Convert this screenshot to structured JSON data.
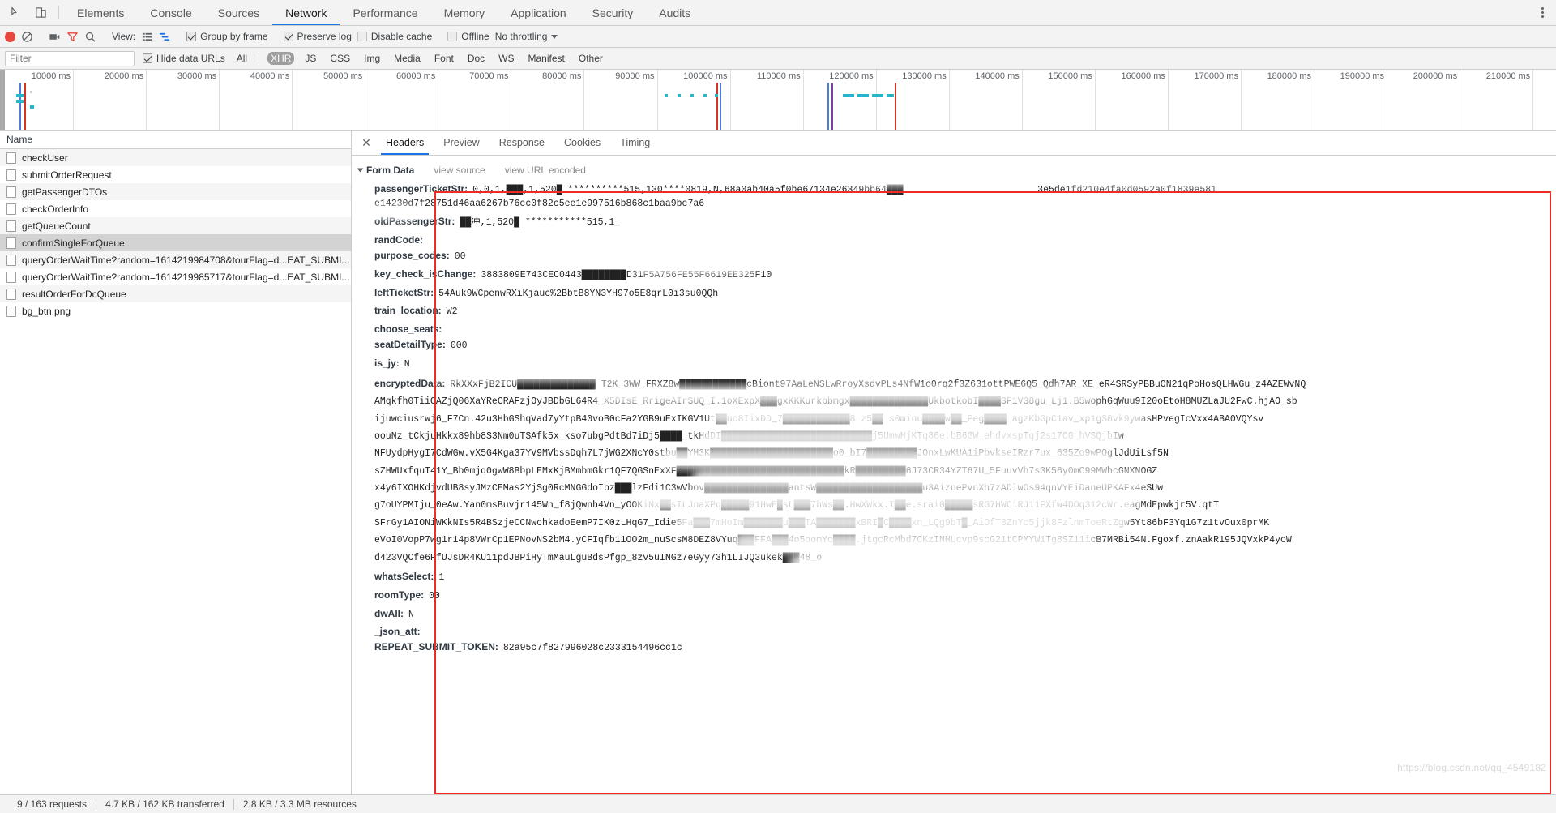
{
  "window": {
    "devtools_tabs": [
      {
        "label": "Elements",
        "active": false
      },
      {
        "label": "Console",
        "active": false
      },
      {
        "label": "Sources",
        "active": false
      },
      {
        "label": "Network",
        "active": true
      },
      {
        "label": "Performance",
        "active": false
      },
      {
        "label": "Memory",
        "active": false
      },
      {
        "label": "Application",
        "active": false
      },
      {
        "label": "Security",
        "active": false
      },
      {
        "label": "Audits",
        "active": false
      }
    ],
    "inspect_icon": "inspect-element-icon",
    "device_icon": "device-toolbar-icon",
    "menu_icon": "kebab-menu-icon"
  },
  "toolbar": {
    "record_icon": "record-button",
    "clear_icon": "clear-button",
    "capture_screenshots_icon": "camera-icon",
    "filter_icon": "funnel-icon",
    "search_icon": "search-icon",
    "view_label": "View:",
    "view_list_icon": "list-view-icon",
    "view_waterfall_icon": "waterfall-view-icon",
    "group_by_frame": {
      "label": "Group by frame",
      "checked": true
    },
    "preserve_log": {
      "label": "Preserve log",
      "checked": true
    },
    "disable_cache": {
      "label": "Disable cache",
      "checked": false
    },
    "offline": {
      "label": "Offline",
      "checked": false
    },
    "throttling": {
      "value": "No throttling",
      "caret_icon": "chevron-down-icon"
    }
  },
  "filterbar": {
    "filter_placeholder": "Filter",
    "filter_value": "",
    "hide_data_urls": {
      "label": "Hide data URLs",
      "checked": true
    },
    "types": [
      {
        "label": "All",
        "selected": false
      },
      {
        "label": "XHR",
        "selected": true
      },
      {
        "label": "JS",
        "selected": false
      },
      {
        "label": "CSS",
        "selected": false
      },
      {
        "label": "Img",
        "selected": false
      },
      {
        "label": "Media",
        "selected": false
      },
      {
        "label": "Font",
        "selected": false
      },
      {
        "label": "Doc",
        "selected": false
      },
      {
        "label": "WS",
        "selected": false
      },
      {
        "label": "Manifest",
        "selected": false
      },
      {
        "label": "Other",
        "selected": false
      }
    ]
  },
  "overview": {
    "ticks": [
      "10000 ms",
      "20000 ms",
      "30000 ms",
      "40000 ms",
      "50000 ms",
      "60000 ms",
      "70000 ms",
      "80000 ms",
      "90000 ms",
      "100000 ms",
      "110000 ms",
      "120000 ms",
      "130000 ms",
      "140000 ms",
      "150000 ms",
      "160000 ms",
      "170000 ms",
      "180000 ms",
      "190000 ms",
      "200000 ms",
      "210000 ms"
    ]
  },
  "requests": {
    "column_header": "Name",
    "rows": [
      {
        "name": "checkUser",
        "selected": false
      },
      {
        "name": "submitOrderRequest",
        "selected": false
      },
      {
        "name": "getPassengerDTOs",
        "selected": false
      },
      {
        "name": "checkOrderInfo",
        "selected": false
      },
      {
        "name": "getQueueCount",
        "selected": false
      },
      {
        "name": "confirmSingleForQueue",
        "selected": true
      },
      {
        "name": "queryOrderWaitTime?random=1614219984708&tourFlag=d...EAT_SUBMI...",
        "selected": false
      },
      {
        "name": "queryOrderWaitTime?random=1614219985717&tourFlag=d...EAT_SUBMI...",
        "selected": false
      },
      {
        "name": "resultOrderForDcQueue",
        "selected": false
      },
      {
        "name": "bg_btn.png",
        "selected": false
      }
    ]
  },
  "detail": {
    "close_icon": "close-icon",
    "tabs": [
      {
        "label": "Headers",
        "active": true
      },
      {
        "label": "Preview",
        "active": false
      },
      {
        "label": "Response",
        "active": false
      },
      {
        "label": "Cookies",
        "active": false
      },
      {
        "label": "Timing",
        "active": false
      }
    ],
    "section": {
      "title": "Form Data",
      "expanded": true,
      "view_source": "view source",
      "view_url_encoded": "view URL encoded"
    },
    "form_data": [
      {
        "key": "passengerTicketStr",
        "value": "0,0,1,███,1,520█ **********515,130****0819,N,68a0ab40a5f0be67134e26349bb64███                        3e5de1fd210e4fa0d0592a0f1839e581",
        "value2": "e14230d7f28751d46aa6267b76cc0f82c5ee1e997516b868c1baa9bc7a6",
        "multiline": true
      },
      {
        "key": "oldPassengerStr",
        "value": "██冲,1,520█ ***********515,1_"
      },
      {
        "key": "randCode",
        "value": ""
      },
      {
        "key": "purpose_codes",
        "value": "00"
      },
      {
        "key": "key_check_isChange",
        "value": "3883809E743CEC0443████████D31F5A756FE55F6619EE325F10"
      },
      {
        "key": "leftTicketStr",
        "value": "54Auk9WCpenwRXiKjauc%2BbtB8YN3YH97o5E8qrL0i3su0QQh"
      },
      {
        "key": "train_location",
        "value": "W2"
      },
      {
        "key": "choose_seats",
        "value": ""
      },
      {
        "key": "seatDetailType",
        "value": "000"
      },
      {
        "key": "is_jy",
        "value": "N"
      },
      {
        "key": "encryptedData",
        "multiline": true,
        "lines": [
          "RkXXxFjB2ICU██████████████ T2K_3WW_FRXZ8w████████████cBiont97AaLeNSLwRroyXsdvPLs4NfW1o0rq2f3Z631ottPWE6Q5_Qdh7AR_XE_eR4SRSyPBBuON21qPoHosQLHWGu_z4AZEWvNQ",
          "AMqkfh0TiiOAZjQ06XaYReCRAFzjOyJBDbGL64R4_X5DIsE_RrigeAIrSUQ_I.1oXExpX███gxKKKurkbbmgx██████████████UkbotkobI████3F1V38gu_Lj1.B5wophGqWuu9I20oEtoH8MUZLaJU2FwC.hjAO_sb",
          "ijuwciusrwj6_F7Cn.42u3HbGShqVad7yYtpB40voB0cFa2YGB9uExIKGV1Ut██uc8IixDD_7████████████8 z5██ s0minu████w██_Peg████ agzKbGpC1av_xp1gS0vk9ywasHPvegIcVxx4ABA0VQYsv",
          "oouNz_tCkjuHkkx89hb8S3Nm0uTSAfk5x_kso7ubgPdtBd7iDj5████_tkHdDI███████████████████████████j5UmwHjKTq86e.bB6GW_ehdvxspTqj2s17CG_hVSQjbIw",
          "NFUydpHygI7CdWGw.vX5G4Kga37YV9MVbssDqh7L7jWG2XNcY0stbu██YH3K██████████████████████o0_bI7█████████JOnxLwKUA1iPbvkseIRzr7ux_635Zo9wPOglJdUiLsf5N",
          "sZHWUxfquT41Y_Bb0mjq0gwW8BbpLEMxKjBMmbmGkr1QF7QGSnExXF██████████████████████████████kR█████████6J73CR34YZT67U_5FuuvVh7s3K56y0mC99MWhcGNXNOGZ",
          "x4y6IXOHKdjvdUB8syJMzCEMas2YjSg0RcMNGGdoIbz███lzFdi1C3wVbov███████████████antsW███████████████████u3AiznePvnXh7zADlwOs94qnVYEiDaneUPKAFx4eSUw",
          "g7oUYPMIju_0eAw.Yan0msBuvjr145Wn_f8jQwnh4Vn_yOOKiMx██sILJnaXPq█████91HwE█sL███7hWs██.HwXWkx.I██e.srai0█████sRG7HWCiRJ11FXfw4DOq312cWr.eagMdEpwkjr5V.qtT",
          "SFrGy1AIONiWKkNIs5R4BSzjeCCNwchkadoEemP7IK0zLHqG7_Idie5Fa███7mHoIm███████u███TA███████xBRI█C████xn_LQg9bT█_AiOfT8ZnYc5jjk8FzlnmToeRtZgw5Yt86bF3Yq1G7z1tvOux0prMK",
          "eVoI0VopP7wg1r14p8VWrCp1EPNovNS2bM4.yCFIqfb11OO2m_nuScsM8DEZ8VYuq███FFA███4o5oomYc████.jtgcRcMbd7CKzINHUcvp9scG21tCPMYW1Tg8SZ11icB7MRBi54N.Fgoxf.znAakR195JQVxkP4yoW",
          "d423VQCfe6PfUJsDR4KU11pdJBPiHyTmMauLguBdsPfgp_8zv5uINGz7eGyy73h1LIJQ3ukek███48_o"
        ]
      },
      {
        "key": "whatsSelect",
        "value": "1"
      },
      {
        "key": "roomType",
        "value": "00"
      },
      {
        "key": "dwAll",
        "value": "N"
      },
      {
        "key": "_json_att",
        "value": ""
      },
      {
        "key": "REPEAT_SUBMIT_TOKEN",
        "value": "82a95c7f827996028c2333154496cc1c"
      }
    ]
  },
  "statusbar": {
    "requests": "9 / 163 requests",
    "transferred": "4.7 KB / 162 KB transferred",
    "resources": "2.8 KB / 3.3 MB resources"
  },
  "watermark": "https://blog.csdn.net/qq_4549182",
  "colors": {
    "accent": "#1a73e8",
    "record": "#e8473f",
    "highlight_box": "#ee2b24",
    "selected_filter_bg": "#9e9e9e"
  }
}
